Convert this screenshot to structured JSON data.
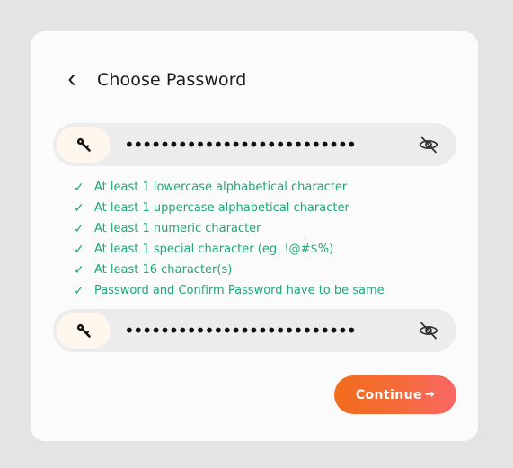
{
  "header": {
    "title": "Choose Password",
    "back_icon": "chevron-left-icon"
  },
  "password_field": {
    "value": "••••••••••••••••••••••••••",
    "icons": [
      "key-icon",
      "eye-off-icon"
    ]
  },
  "confirm_field": {
    "value": "••••••••••••••••••••••••••",
    "icons": [
      "key-icon",
      "eye-off-icon"
    ]
  },
  "rules": {
    "items": [
      "At least 1 lowercase alphabetical character",
      "At least 1 uppercase alphabetical character",
      "At least 1 numeric character",
      "At least 1 special character (eg. !@#$%)",
      "At least 16 character(s)",
      "Password and Confirm Password have to be same"
    ],
    "check_mark": "✓",
    "color": "#1fa67a"
  },
  "continue_button": {
    "label": "Continue",
    "arrow": "→",
    "gradient": [
      "#f26d1c",
      "#f96868"
    ]
  }
}
